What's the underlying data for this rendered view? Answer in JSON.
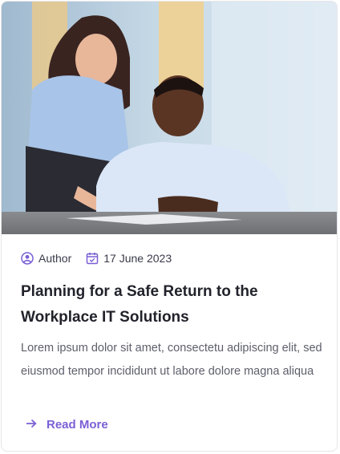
{
  "post": {
    "author": "Author",
    "date": "17 June 2023",
    "title": "Planning for a Safe Return to the Workplace IT Solutions",
    "excerpt": "Lorem ipsum dolor sit amet, consectetu adipiscing elit, sed eiusmod tempor incididunt ut labore dolore magna aliqua",
    "read_more_label": "Read More"
  },
  "icons": {
    "author": "user-circle-icon",
    "date": "calendar-check-icon",
    "read_more": "arrow-right-icon"
  },
  "colors": {
    "accent": "#7a5fd6",
    "title": "#22222b",
    "body_text": "#5e5e6b"
  }
}
